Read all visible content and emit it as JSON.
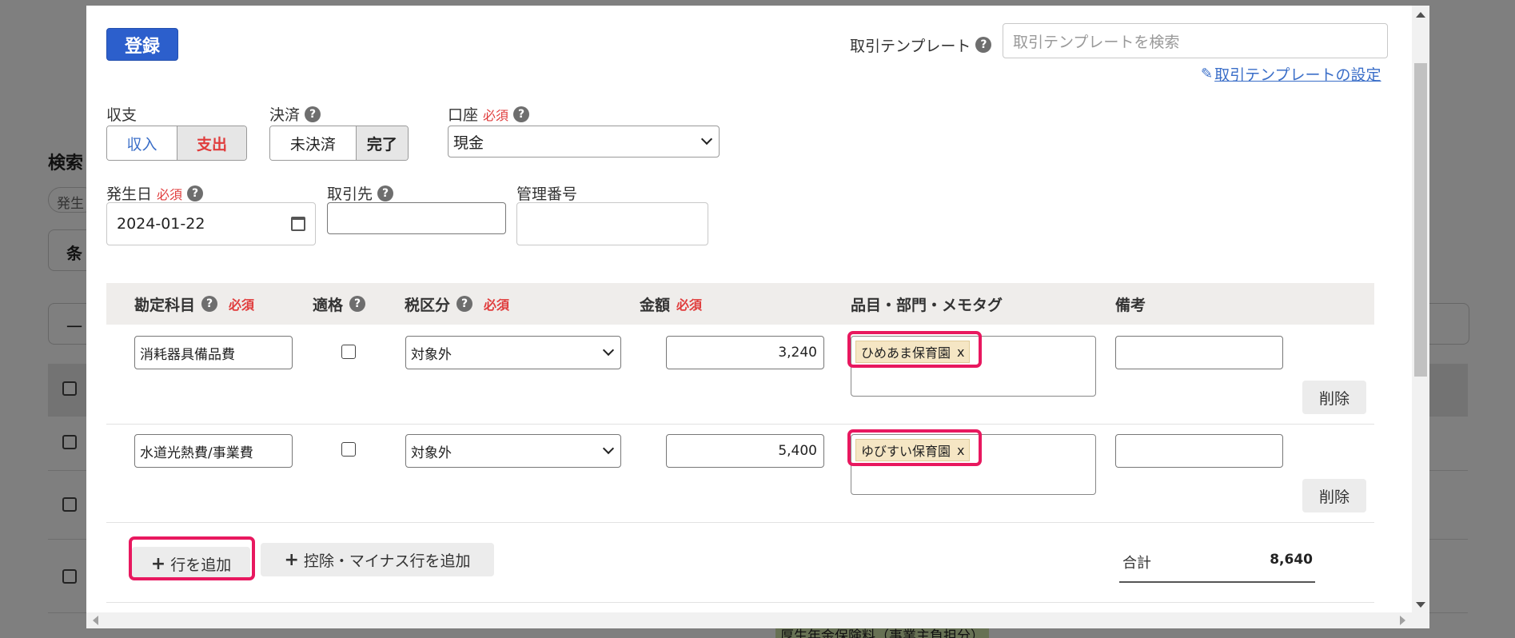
{
  "background": {
    "search_heading": "検索",
    "chip_text": "発生",
    "cond_button": "条",
    "select_text": "一",
    "footer_tag": "厚生年金保険料（事業主負担分）"
  },
  "toolbar": {
    "register_label": "登録",
    "template_label": "取引テンプレート",
    "template_placeholder": "取引テンプレートを検索",
    "template_settings_link": "取引テンプレートの設定"
  },
  "form": {
    "balance": {
      "label": "収支",
      "options": [
        "収入",
        "支出"
      ],
      "selected": "支出"
    },
    "settlement": {
      "label": "決済",
      "options": [
        "未決済",
        "完了"
      ],
      "selected": "完了"
    },
    "account": {
      "label": "口座",
      "required": "必須",
      "value": "現金"
    },
    "date": {
      "label": "発生日",
      "required": "必須",
      "value": "2024-01-22"
    },
    "partner": {
      "label": "取引先",
      "value": ""
    },
    "mgmt_no": {
      "label": "管理番号",
      "value": ""
    }
  },
  "table": {
    "headers": {
      "account": "勘定科目",
      "account_req": "必須",
      "qualified": "適格",
      "tax": "税区分",
      "tax_req": "必須",
      "amount": "金額",
      "amount_req": "必須",
      "tags": "品目・部門・メモタグ",
      "note": "備考"
    },
    "rows": [
      {
        "account": "消耗器具備品費",
        "qualified": false,
        "tax": "対象外",
        "amount": "3,240",
        "tag": "ひめあま保育園",
        "tag_remove": "x",
        "note": "",
        "delete": "削除"
      },
      {
        "account": "水道光熱費/事業費",
        "qualified": false,
        "tax": "対象外",
        "amount": "5,400",
        "tag": "ゆびすい保育園",
        "tag_remove": "x",
        "note": "",
        "delete": "削除"
      }
    ],
    "add_row": "行を追加",
    "add_minus_row": "控除・マイナス行を追加",
    "total_label": "合計",
    "total_value": "8,640"
  },
  "colors": {
    "primary": "#2c5fcc",
    "required": "#e03c3c",
    "highlight": "#e8185f",
    "tag_bg": "#f5e6c4"
  }
}
